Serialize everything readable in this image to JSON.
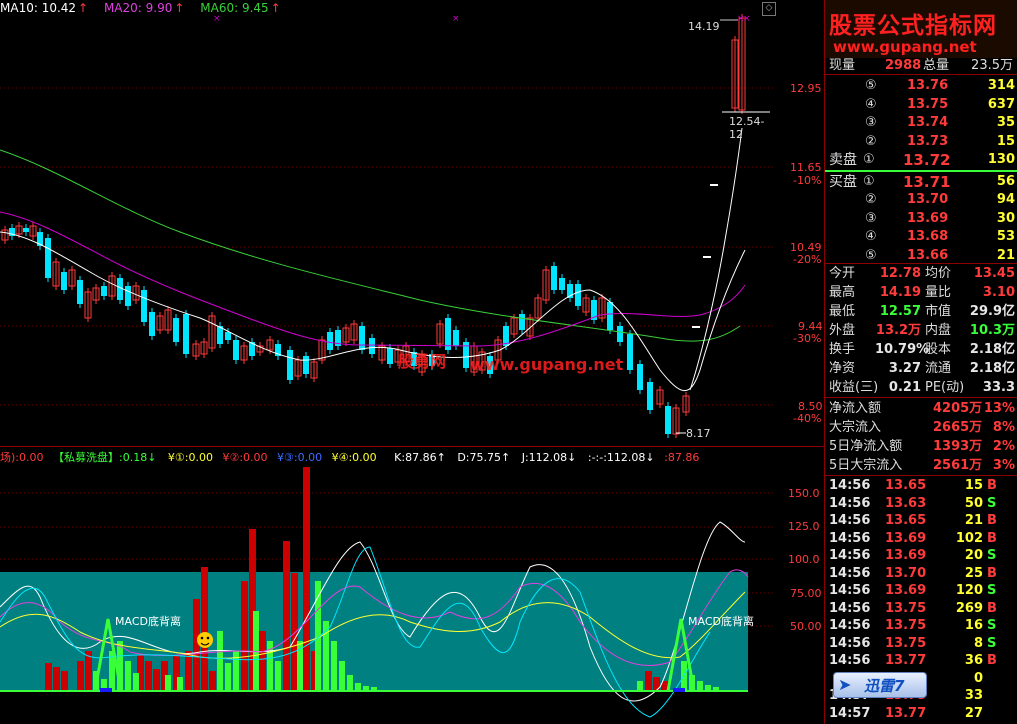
{
  "ma_legend": {
    "ma10": "MA10: 10.42",
    "ma20": "MA20: 9.90",
    "ma60": "MA60: 9.45"
  },
  "price_labels": {
    "high_marker": "14.19",
    "low_marker": "8.17",
    "range_label": "12.54-12"
  },
  "price_axis": [
    {
      "price": "12.95",
      "pct": ""
    },
    {
      "price": "11.65",
      "pct": "-10%"
    },
    {
      "price": "10.49",
      "pct": "-20%"
    },
    {
      "price": "9.44",
      "pct": "-30%"
    },
    {
      "price": "8.50",
      "pct": "-40%"
    }
  ],
  "watermark": {
    "main_text": "股票公式指标网",
    "url_text": "www.gupang.net",
    "chart_overlay_cn": "股勇网",
    "chart_overlay_url": "www.gupang.net"
  },
  "indicator_header": {
    "seg1": "场):0.00",
    "seg2": "【私募洗盘】:0.18↓",
    "seg3": "¥①:0.00",
    "seg4": "¥②:0.00",
    "seg5": "¥③:0.00",
    "seg6": "¥④:0.00",
    "seg7": "K:87.86↑",
    "seg8": "D:75.75↑",
    "seg9": "J:112.08↓",
    "seg10": ":-:-:112.08↓",
    "seg11": ":87.86"
  },
  "indicator_axis": [
    "150.0",
    "125.0",
    "100.0",
    "75.00",
    "50.00"
  ],
  "indicator_annotations": {
    "macd_left": "MACD底背离",
    "macd_right": "MACD底背离"
  },
  "quote_panel": {
    "top_label_left": "现量",
    "top_value_left": "2988",
    "top_label_right": "总量",
    "top_value_right": "23.5万",
    "asks": [
      {
        "level": "⑤",
        "price": "13.76",
        "vol": "314"
      },
      {
        "level": "④",
        "price": "13.75",
        "vol": "637"
      },
      {
        "level": "③",
        "price": "13.74",
        "vol": "35"
      },
      {
        "level": "②",
        "price": "13.73",
        "vol": "15"
      }
    ],
    "ask1": {
      "label": "卖盘",
      "level": "①",
      "price": "13.72",
      "vol": "130"
    },
    "bid1": {
      "label": "买盘",
      "level": "①",
      "price": "13.71",
      "vol": "56"
    },
    "bids": [
      {
        "level": "②",
        "price": "13.70",
        "vol": "94"
      },
      {
        "level": "③",
        "price": "13.69",
        "vol": "30"
      },
      {
        "level": "④",
        "price": "13.68",
        "vol": "53"
      },
      {
        "level": "⑤",
        "price": "13.66",
        "vol": "21"
      }
    ],
    "stats": [
      {
        "l1": "今开",
        "v1": "12.78",
        "c1": "red",
        "l2": "均价",
        "v2": "13.45",
        "c2": "red"
      },
      {
        "l1": "最高",
        "v1": "14.19",
        "c1": "red",
        "l2": "量比",
        "v2": "3.10",
        "c2": "red"
      },
      {
        "l1": "最低",
        "v1": "12.57",
        "c1": "green",
        "l2": "市值",
        "v2": "29.9亿",
        "c2": "white"
      },
      {
        "l1": "外盘",
        "v1": "13.2万",
        "c1": "red",
        "l2": "内盘",
        "v2": "10.3万",
        "c2": "green"
      },
      {
        "l1": "换手",
        "v1": "10.79%",
        "c1": "white",
        "l2": "股本",
        "v2": "2.18亿",
        "c2": "white"
      },
      {
        "l1": "净资",
        "v1": "3.27",
        "c1": "white",
        "l2": "流通",
        "v2": "2.18亿",
        "c2": "white"
      },
      {
        "l1": "收益(三)",
        "v1": "0.21",
        "c1": "white",
        "l2": "PE(动)",
        "v2": "33.3",
        "c2": "white"
      }
    ],
    "flows": [
      {
        "label": "净流入额",
        "value": "4205万",
        "pct": "13%"
      },
      {
        "label": "大宗流入",
        "value": "2665万",
        "pct": "8%"
      },
      {
        "label": "5日净流入额",
        "value": "1393万",
        "pct": "2%"
      },
      {
        "label": "5日大宗流入",
        "value": "2561万",
        "pct": "3%"
      }
    ]
  },
  "ticks": [
    {
      "time": "14:56",
      "price": "13.65",
      "vol": "15",
      "side": "B"
    },
    {
      "time": "14:56",
      "price": "13.63",
      "vol": "50",
      "side": "S"
    },
    {
      "time": "14:56",
      "price": "13.65",
      "vol": "21",
      "side": "B"
    },
    {
      "time": "14:56",
      "price": "13.69",
      "vol": "102",
      "side": "B"
    },
    {
      "time": "14:56",
      "price": "13.69",
      "vol": "20",
      "side": "S"
    },
    {
      "time": "14:56",
      "price": "13.70",
      "vol": "25",
      "side": "B"
    },
    {
      "time": "14:56",
      "price": "13.69",
      "vol": "120",
      "side": "S"
    },
    {
      "time": "14:56",
      "price": "13.75",
      "vol": "269",
      "side": "B"
    },
    {
      "time": "14:56",
      "price": "13.75",
      "vol": "16",
      "side": "S"
    },
    {
      "time": "14:56",
      "price": "13.75",
      "vol": "8",
      "side": "S"
    },
    {
      "time": "14:56",
      "price": "13.77",
      "vol": "36",
      "side": "B"
    },
    {
      "time": "",
      "price": "",
      "vol": "0",
      "side": ""
    },
    {
      "time": "14:57",
      "price": "13.75",
      "vol": "33",
      "side": ""
    },
    {
      "time": "14:57",
      "price": "13.77",
      "vol": "27",
      "side": ""
    }
  ],
  "xunlei_badge": "迅雷7",
  "colors": {
    "up": "#ff3b3b",
    "down": "#00e5ff",
    "ma10": "#ffffff",
    "ma20": "#d000d0",
    "ma60": "#39d039",
    "teal_bg": "#008080"
  }
}
